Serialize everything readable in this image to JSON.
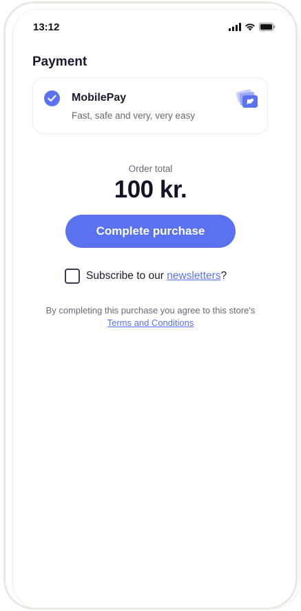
{
  "status_bar": {
    "time": "13:12"
  },
  "payment": {
    "section_title": "Payment",
    "method": {
      "name": "MobilePay",
      "description": "Fast, safe and very, very easy",
      "selected": true
    }
  },
  "order": {
    "total_label": "Order total",
    "total_amount": "100 kr."
  },
  "actions": {
    "purchase_label": "Complete purchase"
  },
  "subscribe": {
    "prefix": "Subscribe to our ",
    "link_text": "newsletters",
    "suffix": "?",
    "checked": false
  },
  "legal": {
    "text": "By completing this purchase you agree to this store's",
    "link_text": "Terms and Conditions"
  },
  "colors": {
    "accent": "#5a72ef",
    "text_primary": "#1b1a2e",
    "text_secondary": "#6a6876",
    "border": "#ecebe8"
  },
  "icons": {
    "status": [
      "signal-icon",
      "wifi-icon",
      "battery-icon"
    ],
    "selected": "check-icon",
    "method_logo": "mobilepay-logo-icon"
  }
}
